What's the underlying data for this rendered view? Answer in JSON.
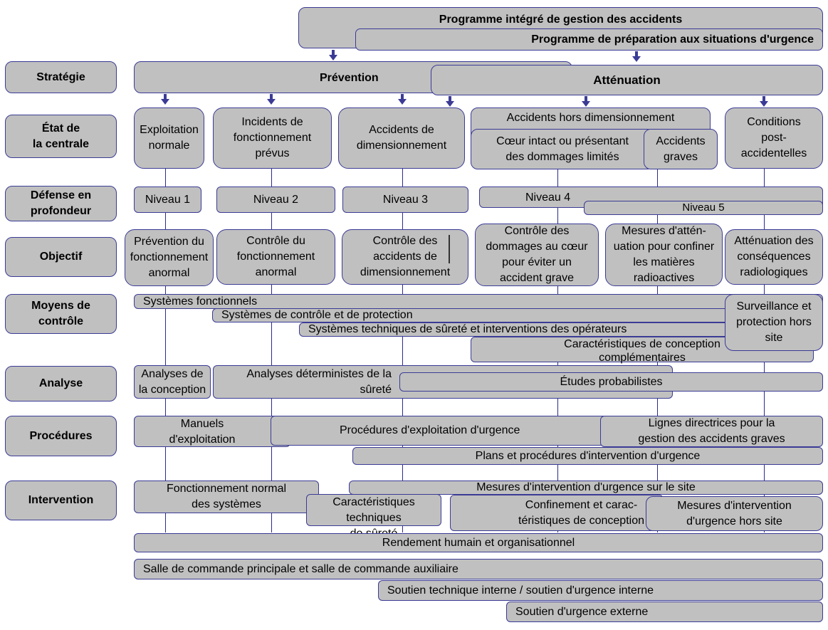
{
  "programs": {
    "integrated": "Programme intégré de gestion des accidents",
    "emergency_preparedness": "Programme de préparation aux situations d'urgence"
  },
  "row_labels": {
    "strategy": "Stratégie",
    "plant_state": [
      "État de",
      "la centrale"
    ],
    "defence_in_depth": [
      "Défense en",
      "profondeur"
    ],
    "objective": "Objectif",
    "means_of_control": [
      "Moyens de",
      "contrôle"
    ],
    "analysis": "Analyse",
    "procedures": "Procédures",
    "response": "Intervention"
  },
  "strategy": {
    "prevention": "Prévention",
    "mitigation": "Atténuation"
  },
  "plant_states": {
    "normal_operation": [
      "Exploitation",
      "normale"
    ],
    "anticipated_incidents": [
      "Incidents de",
      "fonctionnement",
      "prévus"
    ],
    "design_basis_accidents": [
      "Accidents de",
      "dimensionnement"
    ],
    "beyond_design_basis": "Accidents hors dimensionnement",
    "core_intact": [
      "Cœur intact ou présentant",
      "des dommages limités"
    ],
    "severe_accidents": [
      "Accidents",
      "graves"
    ],
    "post_accident": [
      "Conditions",
      "post-",
      "accidentelles"
    ]
  },
  "levels": {
    "level1": "Niveau 1",
    "level2": "Niveau 2",
    "level3": "Niveau 3",
    "level4": "Niveau 4",
    "level5": "Niveau 5"
  },
  "objectives": {
    "o1": [
      "Prévention du",
      "fonctionnement",
      "anormal"
    ],
    "o2": [
      "Contrôle du",
      "fonctionnement",
      "anormal"
    ],
    "o3": [
      "Contrôle des",
      "accidents de",
      "dimensionnement"
    ],
    "o4": [
      "Contrôle des",
      "dommages au cœur",
      "pour éviter un",
      "accident grave"
    ],
    "o5": [
      "Mesures d'attén-",
      "uation pour confiner",
      "les matières",
      "radioactives"
    ],
    "o6": [
      "Atténuation des",
      "conséquences",
      "radiologiques"
    ]
  },
  "means": {
    "functional_systems": "Systèmes fonctionnels",
    "control_protection": "Systèmes de contrôle et de protection",
    "safety_systems": "Systèmes techniques de sûreté et interventions des opérateurs",
    "complementary_design": [
      "Caractéristiques de conception",
      "complémentaires"
    ],
    "offsite_monitoring": [
      "Surveillance et",
      "protection hors",
      "site"
    ]
  },
  "analysis": {
    "design_analysis": [
      "Analyses de",
      "la conception"
    ],
    "deterministic": [
      "Analyses déterministes de la",
      "sûreté"
    ],
    "probabilistic": "Études probabilistes"
  },
  "procedures": {
    "operating_manuals": [
      "Manuels",
      "d'exploitation"
    ],
    "emergency_operating": "Procédures d'exploitation d'urgence",
    "sam_guidelines": [
      "Lignes directrices pour la",
      "gestion des accidents graves"
    ],
    "emergency_plans": "Plans et procédures d'intervention d'urgence"
  },
  "response": {
    "normal_systems": [
      "Fonctionnement normal",
      "des systèmes"
    ],
    "onsite_emergency": "Mesures d'intervention d'urgence sur le site",
    "safety_features": [
      "Caractéristiques techniques",
      "de sûreté"
    ],
    "containment": [
      "Confinement et carac-",
      "téristiques de conception"
    ],
    "offsite_emergency": [
      "Mesures d'intervention",
      "d'urgence hors site"
    ]
  },
  "cross_cutting": {
    "human_performance": "Rendement humain et organisationnel",
    "control_rooms": "Salle de commande principale et salle de commande auxiliaire",
    "internal_support": "Soutien technique interne / soutien d'urgence interne",
    "external_support": "Soutien d'urgence externe"
  },
  "colors": {
    "box_fill": "#c0c0c0",
    "box_border": "#3b3b96",
    "arrow": "#3b3b96",
    "connector": "#2b2b8f"
  }
}
